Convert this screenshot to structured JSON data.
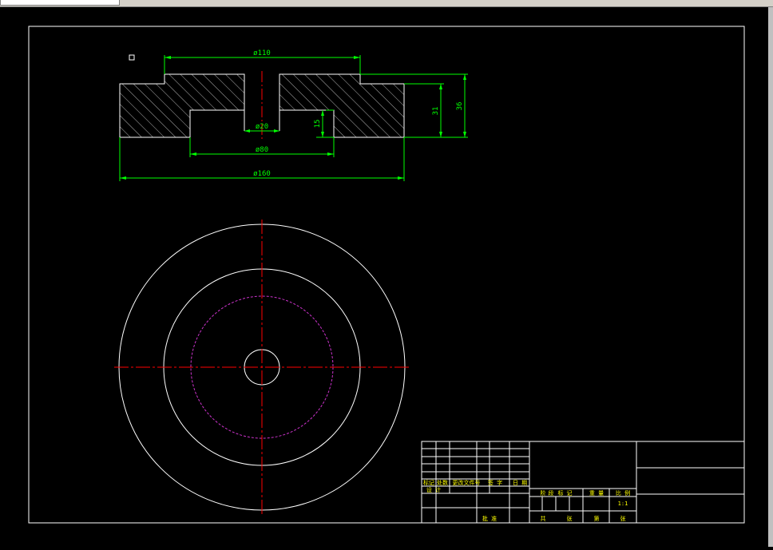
{
  "colors": {
    "background": "#000000",
    "outline": "#ffffff",
    "dimension": "#00ff00",
    "centerline": "#ff0000",
    "hidden_circle": "#cc33cc",
    "title_text": "#ffff00"
  },
  "drawing": {
    "dimensions": {
      "d110": "ø110",
      "d20": "ø20",
      "d80": "ø80",
      "d160": "ø160",
      "h15": "15",
      "h31": "31",
      "h36": "36"
    },
    "title_block": {
      "revision_headers": [
        "标记",
        "处数",
        "更改文件号",
        "签 字",
        "日 期"
      ],
      "designer_label": "设 计",
      "approve_label": "批 准",
      "stage_labels": [
        "阶",
        "段",
        "标",
        "记"
      ],
      "weight_label": "重 量",
      "scale_label": "比 例",
      "scale_value": "1:1",
      "sheet_labels": [
        "共",
        "张",
        "第",
        "张"
      ]
    }
  }
}
